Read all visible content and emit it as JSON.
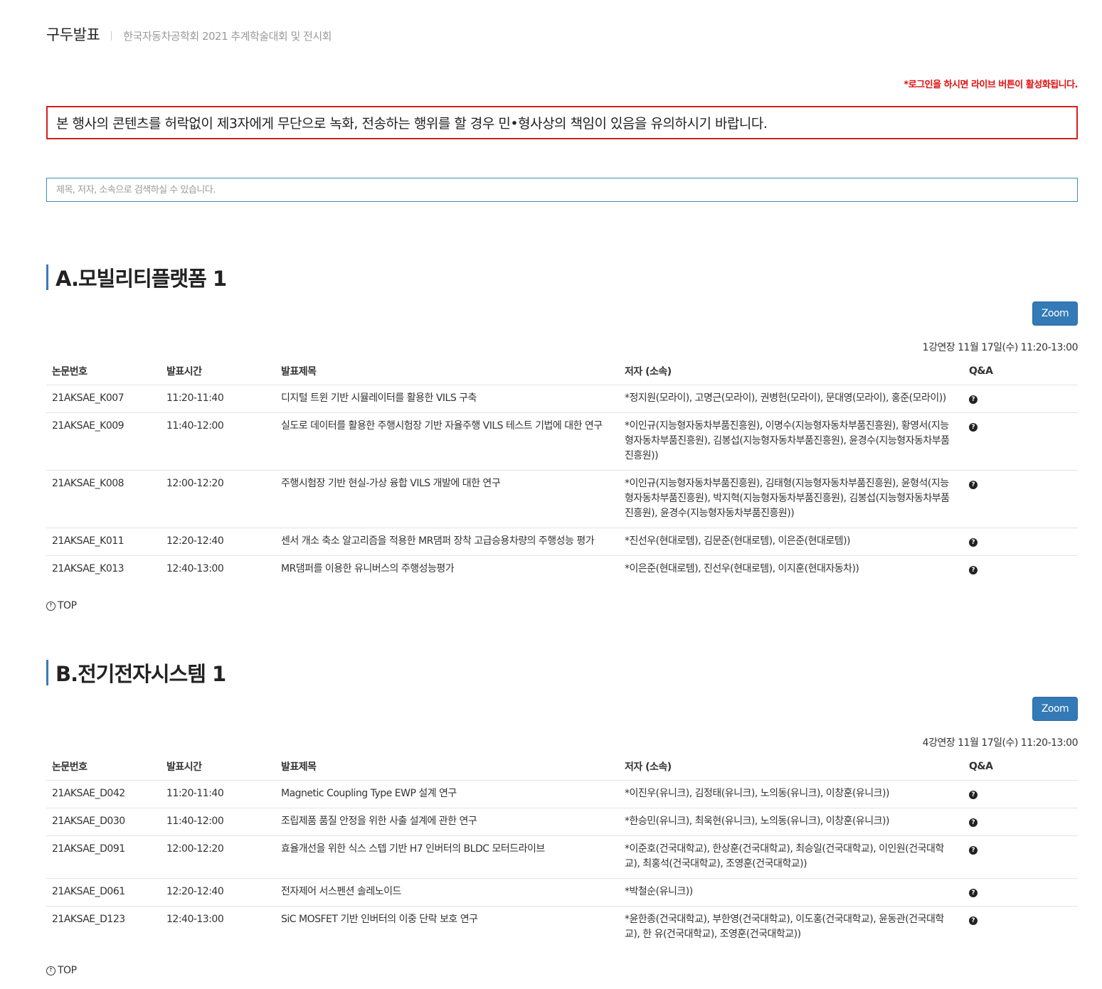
{
  "header": {
    "title": "구두발표",
    "subtitle": "한국자동차공학회 2021 추계학술대회 및 전시회"
  },
  "login_notice": "*로그인을 하시면 라이브 버튼이 활성화됩니다.",
  "warning": "본 행사의 콘텐츠를 허락없이 제3자에게 무단으로 녹화, 전송하는 행위를 할 경우 민•형사상의 책임이 있음을 유의하시기 바랍니다.",
  "search": {
    "placeholder": "제목, 저자, 소속으로 검색하실 수 있습니다."
  },
  "columns": [
    "논문번호",
    "발표시간",
    "발표제목",
    "저자 (소속)",
    "Q&A"
  ],
  "top_label": "TOP",
  "sections": [
    {
      "title": "A.모빌리티플랫폼 1",
      "zoom_label": "Zoom",
      "session_info": "1강연장 11월 17일(수) 11:20-13:00",
      "rows": [
        {
          "id": "21AKSAE_K007",
          "time": "11:20-11:40",
          "title": "디지털 트윈 기반 시뮬레이터를 활용한 VILS 구축",
          "authors": "*정지원(모라이), 고명근(모라이), 권병헌(모라이), 문대영(모라이), 홍준(모라이))"
        },
        {
          "id": "21AKSAE_K009",
          "time": "11:40-12:00",
          "title": "실도로 데이터를 활용한 주행시험장 기반 자율주행 VILS 테스트 기법에 대한 연구",
          "authors": "*이인규(지능형자동차부품진흥원), 이명수(지능형자동차부품진흥원), 황영서(지능형자동차부품진흥원), 김봉섭(지능형자동차부품진흥원), 윤경수(지능형자동차부품진흥원))"
        },
        {
          "id": "21AKSAE_K008",
          "time": "12:00-12:20",
          "title": "주행시험장 기반 현실-가상 융합 VILS 개발에 대한 연구",
          "authors": "*이인규(지능형자동차부품진흥원), 김태형(지능형자동차부품진흥원), 윤형석(지능형자동차부품진흥원), 박지혁(지능형자동차부품진흥원), 김봉섭(지능형자동차부품진흥원), 윤경수(지능형자동차부품진흥원))"
        },
        {
          "id": "21AKSAE_K011",
          "time": "12:20-12:40",
          "title": "센서 개소 축소 알고리즘을 적용한 MR댐퍼 장착 고급승용차량의 주행성능 평가",
          "authors": "*진선우(현대로템), 김문준(현대로템), 이은준(현대로템))"
        },
        {
          "id": "21AKSAE_K013",
          "time": "12:40-13:00",
          "title": "MR댐퍼를 이용한 유니버스의 주행성능평가",
          "authors": "*이은준(현대로템), 진선우(현대로템), 이지훈(현대자동차))"
        }
      ]
    },
    {
      "title": "B.전기전자시스템 1",
      "zoom_label": "Zoom",
      "session_info": "4강연장 11월 17일(수) 11:20-13:00",
      "rows": [
        {
          "id": "21AKSAE_D042",
          "time": "11:20-11:40",
          "title": "Magnetic Coupling Type EWP 설계 연구",
          "authors": "*이진우(유니크), 김정태(유니크), 노의동(유니크), 이창훈(유니크))"
        },
        {
          "id": "21AKSAE_D030",
          "time": "11:40-12:00",
          "title": "조립제품 품질 안정을 위한 사출 설계에 관한 연구",
          "authors": "*한승민(유니크), 최욱현(유니크), 노의동(유니크), 이창훈(유니크))"
        },
        {
          "id": "21AKSAE_D091",
          "time": "12:00-12:20",
          "title": "효율개선을 위한 식스 스텝 기반 H7 인버터의 BLDC 모터드라이브",
          "authors": "*이준호(건국대학교), 한상훈(건국대학교), 최승일(건국대학교), 이인원(건국대학교), 최홍석(건국대학교), 조영훈(건국대학교))"
        },
        {
          "id": "21AKSAE_D061",
          "time": "12:20-12:40",
          "title": "전자제어 서스펜션 솔레노이드",
          "authors": "*박철순(유니크))"
        },
        {
          "id": "21AKSAE_D123",
          "time": "12:40-13:00",
          "title": "SiC MOSFET 기반 인버터의 이중 단락 보호 연구",
          "authors": "*윤한종(건국대학교), 부한영(건국대학교), 이도홍(건국대학교), 윤동관(건국대학교), 한 유(건국대학교), 조영훈(건국대학교))"
        }
      ]
    }
  ]
}
